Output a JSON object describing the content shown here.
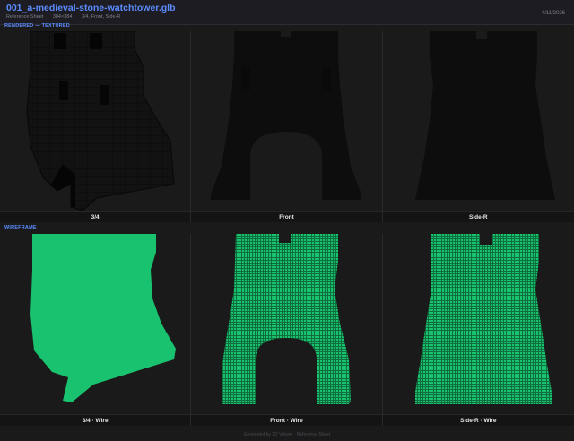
{
  "header": {
    "file_title": "001_a-medieval-stone-watchtower.glb",
    "sheet_label": "Reference Sheet",
    "resolution": "384×384",
    "views_summary": "3/4, Front, Side-R",
    "date": "4/11/2026"
  },
  "sections": {
    "rendered_label": "RENDERED — TEXTURED",
    "wireframe_label": "WIREFRAME"
  },
  "rendered_views": [
    {
      "caption": "3/4"
    },
    {
      "caption": "Front"
    },
    {
      "caption": "Side-R"
    }
  ],
  "wire_views": [
    {
      "caption": "3/4 · Wire"
    },
    {
      "caption": "Front · Wire"
    },
    {
      "caption": "Side-R · Wire"
    }
  ],
  "colors": {
    "accent": "#5b8cff",
    "wire": "#18c26e",
    "model": "#0c0c0c"
  },
  "footer": {
    "text": "Generated by 3D Viewer · Reference Sheet"
  }
}
